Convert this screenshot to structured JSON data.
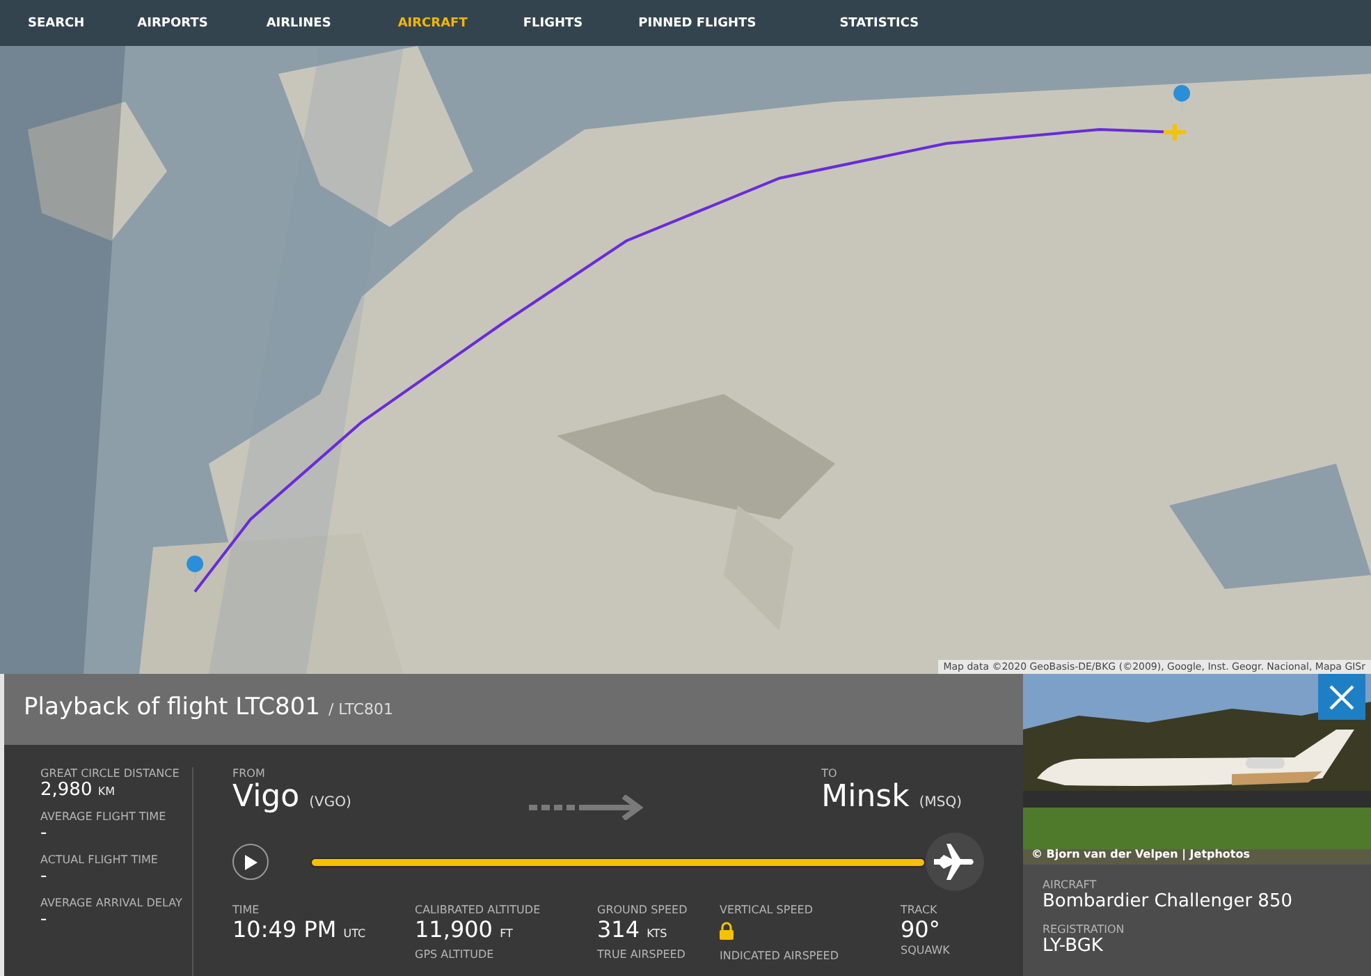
{
  "nav": [
    {
      "label": "SEARCH",
      "selected": false
    },
    {
      "label": "AIRPORTS",
      "selected": false
    },
    {
      "label": "AIRLINES",
      "selected": false
    },
    {
      "label": "AIRCRAFT",
      "selected": true
    },
    {
      "label": "FLIGHTS",
      "selected": false
    },
    {
      "label": "PINNED FLIGHTS",
      "selected": false
    },
    {
      "label": "STATISTICS",
      "selected": false
    }
  ],
  "map": {
    "kind": "picture",
    "attribution": "Map data ©2020 GeoBasis-DE/BKG (©2009), Google, Inst. Geogr. Nacional, Mapa GISr"
  },
  "panel": {
    "title": "Playback of flight LTC801",
    "subtitle": "/ LTC801",
    "stats": [
      {
        "label": "GREAT CIRCLE DISTANCE",
        "value": "2,980",
        "unit": "KM"
      },
      {
        "label": "AVERAGE FLIGHT TIME",
        "value": "-"
      },
      {
        "label": "ACTUAL FLIGHT TIME",
        "value": "-"
      },
      {
        "label": "AVERAGE ARRIVAL DELAY",
        "value": "-"
      }
    ],
    "from": {
      "label": "FROM",
      "city": "Vigo",
      "code": "(VGO)"
    },
    "to": {
      "label": "TO",
      "city": "Minsk",
      "code": "(MSQ)"
    },
    "playback": {
      "level": 1
    },
    "readouts": [
      {
        "kind": "value",
        "label": "TIME",
        "value": "10:49 PM",
        "unit": "UTC"
      },
      {
        "kind": "value",
        "label": "CALIBRATED ALTITUDE",
        "value": "11,900",
        "unit": "FT",
        "sublabel": "GPS ALTITUDE"
      },
      {
        "kind": "value",
        "label": "GROUND SPEED",
        "value": "314",
        "unit": "KTS",
        "sublabel": "TRUE AIRSPEED"
      },
      {
        "kind": "locked",
        "label": "VERTICAL SPEED",
        "sublabel": "INDICATED AIRSPEED"
      },
      {
        "kind": "value",
        "label": "TRACK",
        "value": "90°",
        "sublabel": "SQUAWK"
      }
    ]
  },
  "aircraft": {
    "photo": {
      "kind": "picture",
      "credit": "© Bjorn van der Velpen | Jetphotos"
    },
    "fields": [
      {
        "label": "AIRCRAFT",
        "value": "Bombardier Challenger 850"
      },
      {
        "label": "REGISTRATION",
        "value": "LY-BGK"
      }
    ]
  }
}
